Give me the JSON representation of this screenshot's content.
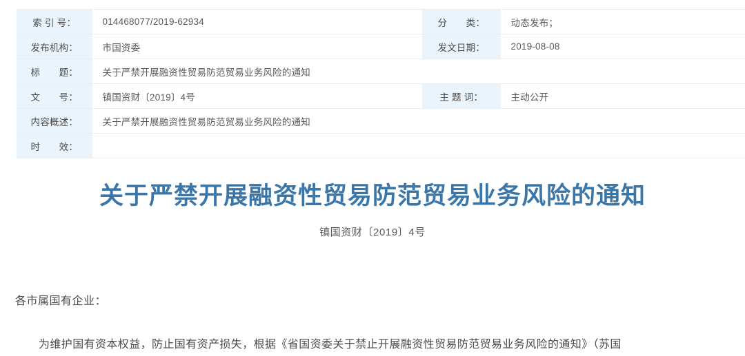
{
  "meta": {
    "rows": [
      {
        "left_label": "索 引 号：",
        "left_value": "014468077/2019-62934",
        "right_label": "分　　类：",
        "right_value": "动态发布；",
        "full_width": false
      },
      {
        "left_label": "发布机构：",
        "left_value": "市国资委",
        "right_label": "发文日期：",
        "right_value": "2019-08-08",
        "full_width": false
      },
      {
        "left_label": "标　　题：",
        "left_value": "关于严禁开展融资性贸易防范贸易业务风险的通知",
        "right_label": "",
        "right_value": "",
        "full_width": true
      },
      {
        "left_label": "文　　号：",
        "left_value": "镇国资财〔2019〕4号",
        "right_label": "主 题 词：",
        "right_value": "主动公开",
        "full_width": false
      },
      {
        "left_label": "内容概述：",
        "left_value": "关于严禁开展融资性贸易防范贸易业务风险的通知",
        "right_label": "",
        "right_value": "",
        "full_width": true
      },
      {
        "left_label": "时　　效：",
        "left_value": "",
        "right_label": "",
        "right_value": "",
        "full_width": true
      }
    ]
  },
  "document": {
    "title": "关于严禁开展融资性贸易防范贸易业务风险的通知",
    "number": "镇国资财〔2019〕4号",
    "salutation": "各市属国有企业：",
    "paragraph": "为维护国有资本权益，防止国有资产损失，根据《省国资委关于禁止开展融资性贸易防范贸易业务风险的通知》（苏国"
  },
  "colors": {
    "title": "#3b76a8",
    "label_background": "#eaf4fd",
    "border": "#e8eef4",
    "body_text": "#4c4c4c"
  }
}
